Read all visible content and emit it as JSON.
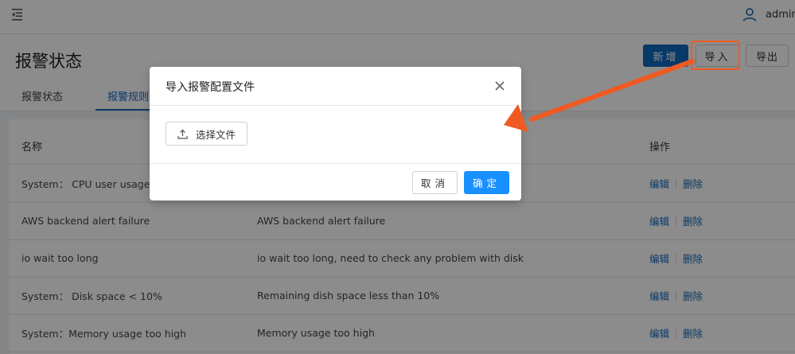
{
  "header": {
    "menu_icon": "menu-fold-icon",
    "user_icon": "user-icon",
    "username": "admin"
  },
  "page": {
    "title": "报警状态",
    "buttons": {
      "new": "新增",
      "import": "导入",
      "export": "导出"
    },
    "tabs": [
      "报警状态",
      "报警规则"
    ]
  },
  "table": {
    "headers": {
      "name": "名称",
      "ops": "操作"
    },
    "rows": [
      {
        "name": "System： CPU user usage",
        "desc": ""
      },
      {
        "name": "AWS backend alert failure",
        "desc": "AWS backend alert failure"
      },
      {
        "name": "io wait too long",
        "desc": "io wait too long, need to check any problem with disk"
      },
      {
        "name": "System： Disk space < 10%",
        "desc": "Remaining dish space less than 10%"
      },
      {
        "name": "System：Memory usage too high",
        "desc": "Memory usage too high"
      }
    ],
    "edit_label": "编辑",
    "delete_label": "删除"
  },
  "modal": {
    "title": "导入报警配置文件",
    "upload_label": "选择文件",
    "cancel_label": "取消",
    "ok_label": "确定"
  },
  "colors": {
    "primary": "#1268bd",
    "ok_button": "#1890ff",
    "annotation": "#ef5a22"
  }
}
